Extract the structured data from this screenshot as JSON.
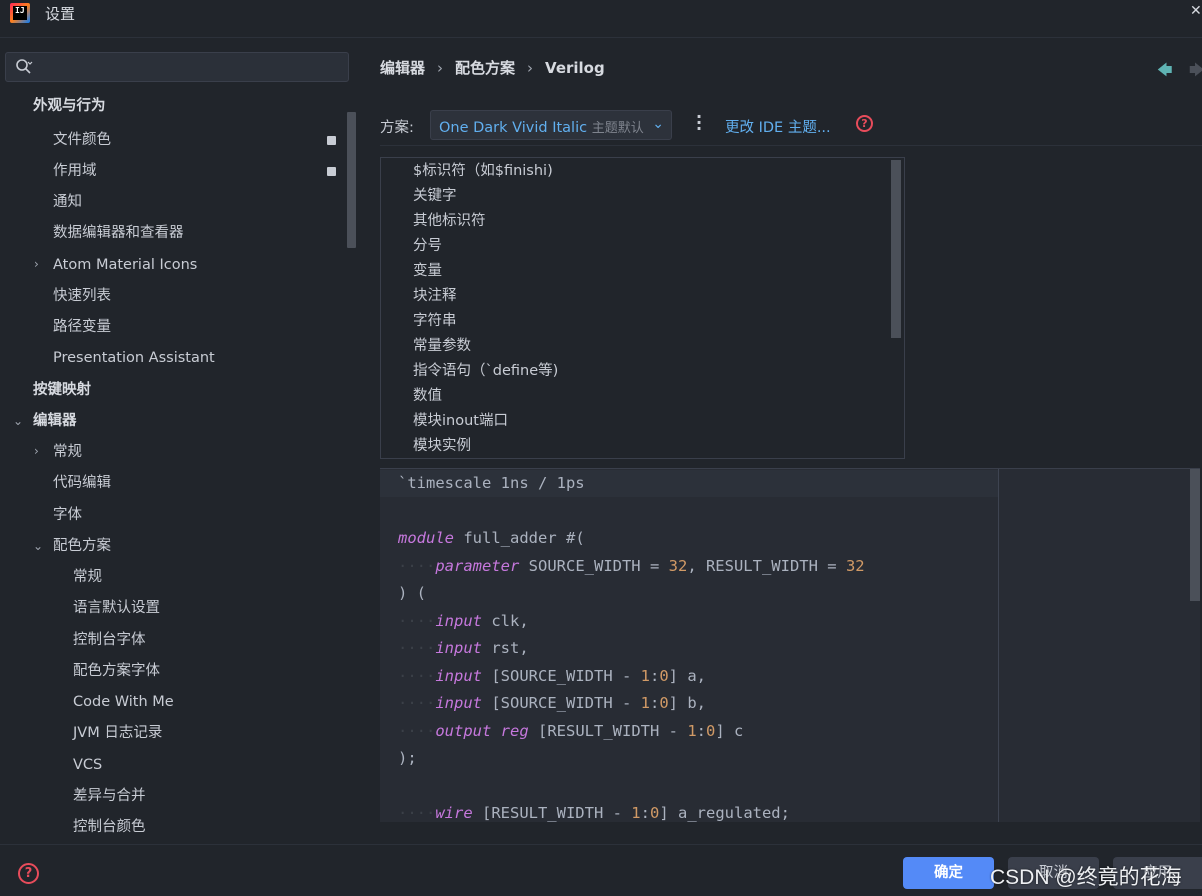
{
  "window": {
    "title": "设置",
    "app_icon_text": "IJ"
  },
  "sidebar": {
    "search_placeholder": "",
    "items": [
      {
        "label": "外观与行为",
        "bold": true
      },
      {
        "label": "文件颜色"
      },
      {
        "label": "作用域"
      },
      {
        "label": "通知"
      },
      {
        "label": "数据编辑器和查看器"
      },
      {
        "label": "Atom Material Icons"
      },
      {
        "label": "快速列表"
      },
      {
        "label": "路径变量"
      },
      {
        "label": "Presentation Assistant"
      },
      {
        "label": "按键映射",
        "bold": true
      },
      {
        "label": "编辑器",
        "bold": true
      },
      {
        "label": "常规"
      },
      {
        "label": "代码编辑"
      },
      {
        "label": "字体"
      },
      {
        "label": "配色方案"
      },
      {
        "label": "常规"
      },
      {
        "label": "语言默认设置"
      },
      {
        "label": "控制台字体"
      },
      {
        "label": "配色方案字体"
      },
      {
        "label": "Code With Me"
      },
      {
        "label": "JVM 日志记录"
      },
      {
        "label": "VCS"
      },
      {
        "label": "差异与合并"
      },
      {
        "label": "控制台颜色"
      }
    ]
  },
  "breadcrumb": [
    "编辑器",
    "配色方案",
    "Verilog"
  ],
  "breadcrumb_sep": "›",
  "scheme": {
    "label": "方案:",
    "value": "One Dark Vivid Italic",
    "suffix": "主题默认",
    "change_link": "更改 IDE 主题..."
  },
  "element_list": [
    "$标识符（如$finishi)",
    "关键字",
    "其他标识符",
    "分号",
    "变量",
    "块注释",
    "字符串",
    "常量参数",
    "指令语句（`define等)",
    "数值",
    "模块inout端口",
    "模块实例"
  ],
  "code_preview": {
    "line1": "`timescale 1ns / 1ps",
    "module_kw": "module",
    "module_rest": " full_adder #(",
    "indent": "····",
    "parameter_kw": "parameter",
    "param_a": " SOURCE_WIDTH = ",
    "param_a_val": "32",
    "param_b": ", RESULT_WIDTH = ",
    "param_b_val": "32",
    "open_ports": ") (",
    "input_kw": "input",
    "output_kw": "output",
    "reg_kw": "reg",
    "wire_kw": "wire",
    "clk": " clk,",
    "rst": " rst,",
    "src_open": " [SOURCE_WIDTH - ",
    "res_open": " [RESULT_WIDTH - ",
    "one": "1",
    "colon_zero": ":",
    "zero": "0",
    "a_tail": "] a,",
    "b_tail": "] b,",
    "c_tail": "] c",
    "close": ");",
    "wire_tail": "] a_regulated;"
  },
  "footer": {
    "ok": "确定",
    "cancel": "取消",
    "apply": "应用",
    "watermark": "CSDN @终竟的花海"
  }
}
